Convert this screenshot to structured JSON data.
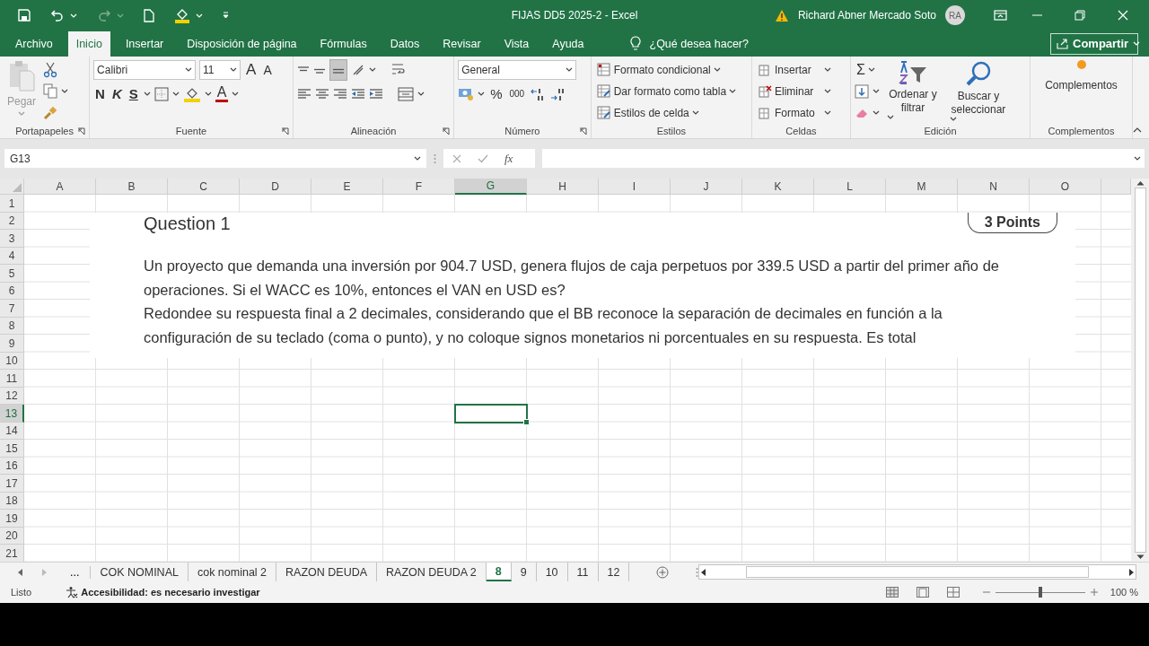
{
  "title_bar": {
    "title": "FIJAS DD5 2025-2  -  Excel",
    "user": "Richard Abner Mercado Soto",
    "avatar": "RA"
  },
  "ribbon_tabs": [
    {
      "label": "Archivo",
      "selected": false
    },
    {
      "label": "Inicio",
      "selected": true
    },
    {
      "label": "Insertar",
      "selected": false
    },
    {
      "label": "Disposición de página",
      "selected": false
    },
    {
      "label": "Fórmulas",
      "selected": false
    },
    {
      "label": "Datos",
      "selected": false
    },
    {
      "label": "Revisar",
      "selected": false
    },
    {
      "label": "Vista",
      "selected": false
    },
    {
      "label": "Ayuda",
      "selected": false
    }
  ],
  "tell_me": "¿Qué desea hacer?",
  "share_button": "Compartir",
  "ribbon": {
    "clipboard": {
      "paste": "Pegar",
      "label": "Portapapeles"
    },
    "font": {
      "font_name": "Calibri",
      "font_size": "11",
      "grow": "A",
      "shrink": "A",
      "bold": "N",
      "italic": "K",
      "underline": "S",
      "font_color": "A",
      "label": "Fuente"
    },
    "alignment": {
      "label": "Alineación"
    },
    "number": {
      "format": "General",
      "percent": "%",
      "thousands": "000",
      "label": "Número"
    },
    "styles": {
      "items": [
        "Formato condicional",
        "Dar formato como tabla",
        "Estilos de celda"
      ],
      "label": "Estilos"
    },
    "cells": {
      "items": [
        "Insertar",
        "Eliminar",
        "Formato"
      ],
      "label": "Celdas"
    },
    "editing": {
      "autosum": "Σ",
      "sort": "Ordenar y filtrar",
      "find": "Buscar y seleccionar",
      "label": "Edición"
    },
    "addins": {
      "button": "Complementos",
      "label": "Complementos"
    }
  },
  "name_box": "G13",
  "formula_fx": "fx",
  "columns": [
    {
      "label": "A",
      "selected": false
    },
    {
      "label": "B",
      "selected": false
    },
    {
      "label": "C",
      "selected": false
    },
    {
      "label": "D",
      "selected": false
    },
    {
      "label": "E",
      "selected": false
    },
    {
      "label": "F",
      "selected": false
    },
    {
      "label": "G",
      "selected": true
    },
    {
      "label": "H",
      "selected": false
    },
    {
      "label": "I",
      "selected": false
    },
    {
      "label": "J",
      "selected": false
    },
    {
      "label": "K",
      "selected": false
    },
    {
      "label": "L",
      "selected": false
    },
    {
      "label": "M",
      "selected": false
    },
    {
      "label": "N",
      "selected": false
    },
    {
      "label": "O",
      "selected": false
    }
  ],
  "rows": [
    {
      "label": "1",
      "selected": false
    },
    {
      "label": "2",
      "selected": false
    },
    {
      "label": "3",
      "selected": false
    },
    {
      "label": "4",
      "selected": false
    },
    {
      "label": "5",
      "selected": false
    },
    {
      "label": "6",
      "selected": false
    },
    {
      "label": "7",
      "selected": false
    },
    {
      "label": "8",
      "selected": false
    },
    {
      "label": "9",
      "selected": false
    },
    {
      "label": "10",
      "selected": false
    },
    {
      "label": "11",
      "selected": false
    },
    {
      "label": "12",
      "selected": false
    },
    {
      "label": "13",
      "selected": true
    },
    {
      "label": "14",
      "selected": false
    },
    {
      "label": "15",
      "selected": false
    },
    {
      "label": "16",
      "selected": false
    },
    {
      "label": "17",
      "selected": false
    },
    {
      "label": "18",
      "selected": false
    },
    {
      "label": "19",
      "selected": false
    },
    {
      "label": "20",
      "selected": false
    },
    {
      "label": "21",
      "selected": false
    }
  ],
  "pasted_image": {
    "title": "Question 1",
    "points": "3 Points",
    "paragraphs": [
      "Un proyecto que demanda una inversión por 904.7 USD, genera flujos de caja perpetuos por 339.5 USD a partir del primer año de operaciones. Si el WACC es 10%, entonces el VAN en USD es?",
      "Redondee su respuesta final a 2 decimales, considerando que el BB reconoce la separación de decimales en función a la configuración de su teclado (coma o punto), y no coloque signos monetarios ni porcentuales en su respuesta. Es total"
    ]
  },
  "more_sheets": "...",
  "sheet_tabs": [
    {
      "label": "COK NOMINAL",
      "selected": false
    },
    {
      "label": "cok nominal 2",
      "selected": false
    },
    {
      "label": "RAZON DEUDA",
      "selected": false
    },
    {
      "label": "RAZON DEUDA 2",
      "selected": false
    },
    {
      "label": "8",
      "selected": true
    },
    {
      "label": "9",
      "selected": false
    },
    {
      "label": "10",
      "selected": false
    },
    {
      "label": "11",
      "selected": false
    },
    {
      "label": "12",
      "selected": false
    }
  ],
  "status_bar": {
    "mode": "Listo",
    "accessibility": "Accesibilidad: es necesario investigar",
    "zoom": {
      "level": 0.5,
      "reading": "100 %"
    }
  }
}
